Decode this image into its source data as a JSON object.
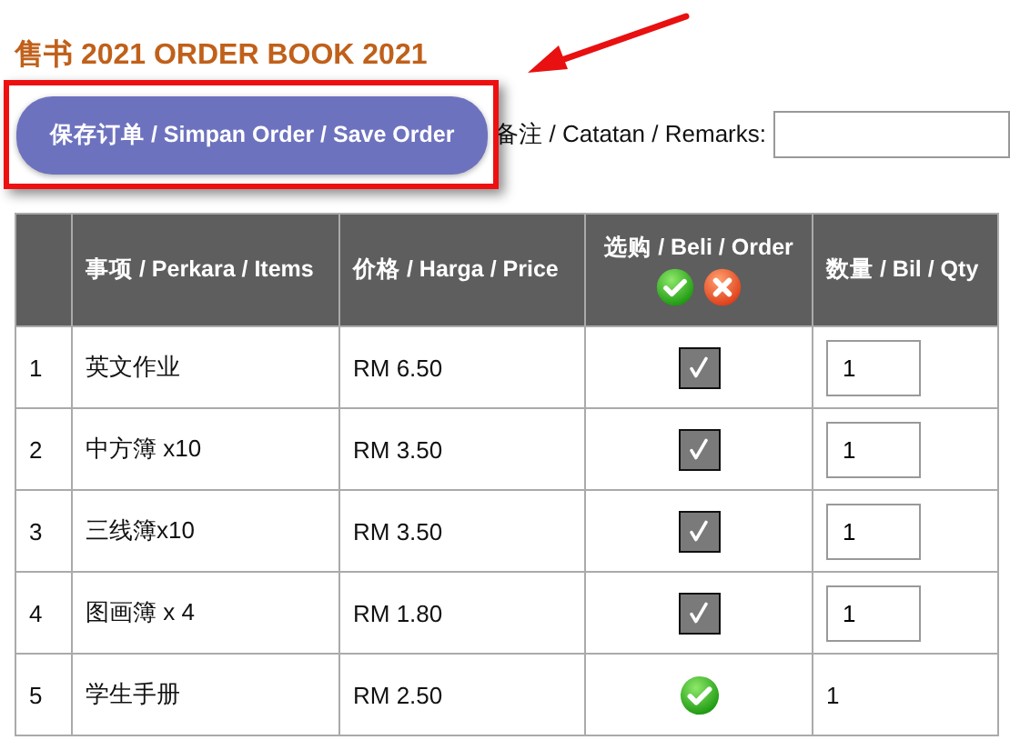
{
  "title": "售书 2021 ORDER BOOK 2021",
  "save_button": "保存订单 / Simpan Order / Save Order",
  "remarks": {
    "label": "备注 / Catatan / Remarks:"
  },
  "table": {
    "columns": [
      "事项 / Perkara / Items",
      "价格 / Harga / Price",
      "选购 / Beli / Order",
      "数量 / Bil / Qty"
    ],
    "rows": [
      {
        "no": "1",
        "item": "英文作业",
        "price": "RM 6.50",
        "kind": "checkbox",
        "checked": true,
        "qty": "1"
      },
      {
        "no": "2",
        "item": "中方簿 x10",
        "price": "RM 3.50",
        "kind": "checkbox",
        "checked": true,
        "qty": "1"
      },
      {
        "no": "3",
        "item": "三线簿x10",
        "price": "RM 3.50",
        "kind": "checkbox",
        "checked": true,
        "qty": "1"
      },
      {
        "no": "4",
        "item": "图画簿 x 4",
        "price": "RM 1.80",
        "kind": "checkbox",
        "checked": true,
        "qty": "1"
      },
      {
        "no": "5",
        "item": "学生手册",
        "price": "RM 2.50",
        "kind": "fixed",
        "qty": "1"
      }
    ]
  }
}
